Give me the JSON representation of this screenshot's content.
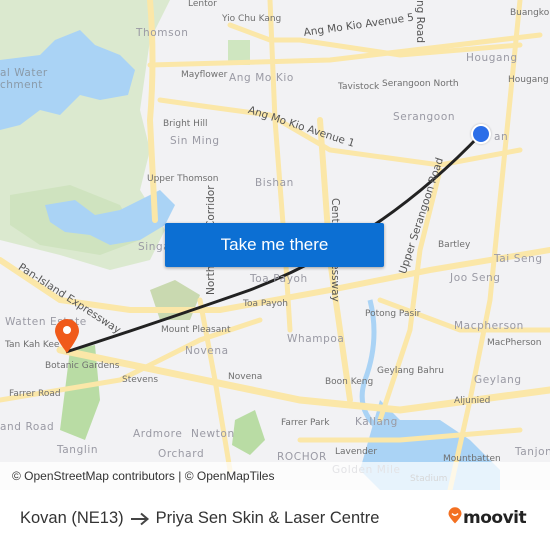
{
  "map": {
    "labels": {
      "lentor": "Lentor",
      "yio_chu_kang": "Yio Chu Kang",
      "thomson": "Thomson",
      "ang_mo_kio_ave5": "Ang Mo Kio Avenue 5",
      "yio_chu_kang_road": "ng Road",
      "buangkok": "Buangkok",
      "hougang_area": "Hougang",
      "hougang_station": "Hougang",
      "central_water_catchment": "al Water\nchment",
      "mayflower": "Mayflower",
      "ang_mo_kio_area": "Ang Mo Kio",
      "tavistock": "Tavistock",
      "serangoon_north": "Serangoon North",
      "serangoon": "Serangoon",
      "kovan": "an",
      "bright_hill": "Bright Hill",
      "sin_ming": "Sin Ming",
      "ang_mo_kio_ave1": "Ang Mo Kio Avenue 1",
      "upper_thomson": "Upper Thomson",
      "bishan": "Bishan",
      "north_south_corridor": "North-South Corridor",
      "central_expressway": "Central Expressway",
      "upper_serangoon_road": "Upper Serangoon Road",
      "singapore": "Singa",
      "bartley": "Bartley",
      "tai_seng": "Tai Seng",
      "joo_seng": "Joo Seng",
      "toa_payoh_area": "Toa Payoh",
      "toa_payoh_station": "Toa Payoh",
      "pan_island_expressway": "Pan-Island Expressway",
      "watten_estate": "Watten Estate",
      "tan_kah_kee": "Tan Kah Kee",
      "mount_pleasant": "Mount Pleasant",
      "potong_pasir": "Potong Pasir",
      "whampoa": "Whampoa",
      "macpherson_area": "Macpherson",
      "macpherson_station": "MacPherson",
      "botanic_gardens": "Botanic Gardens",
      "novena_area": "Novena",
      "novena_station": "Novena",
      "stevens": "Stevens",
      "geylang_bahru": "Geylang Bahru",
      "geylang": "Geylang",
      "boon_keng": "Boon Keng",
      "farrer_road": "Farrer Road",
      "aljunied": "Aljunied",
      "holland_road": "and Road",
      "ardmore": "Ardmore",
      "newton": "Newton",
      "farrer_park": "Farrer Park",
      "kallang": "Kallang",
      "tanglin": "Tanglin",
      "orchard": "Orchard",
      "rochor": "ROCHOR",
      "lavender": "Lavender",
      "golden_mile": "Golden Mile",
      "mountbatten": "Mountbatten",
      "tanjong": "Tanjon",
      "stadium": "Stadium"
    },
    "cta_label": "Take me there",
    "attribution": "© OpenStreetMap contributors | © OpenMapTiles",
    "origin_icon": "current-location-dot",
    "destination_icon": "map-pin",
    "colors": {
      "cta": "#0c6fd3",
      "origin": "#2b6ee8",
      "destination": "#f05a1a",
      "route": "#222222",
      "water": "#aad3f5",
      "park": "#d5e8c8",
      "road": "#fbe7a8"
    }
  },
  "footer": {
    "origin": "Kovan (NE13)",
    "arrow_icon": "arrow-right",
    "destination": "Priya Sen Skin & Laser Centre",
    "brand": "moovit",
    "brand_color": "#f37021"
  }
}
